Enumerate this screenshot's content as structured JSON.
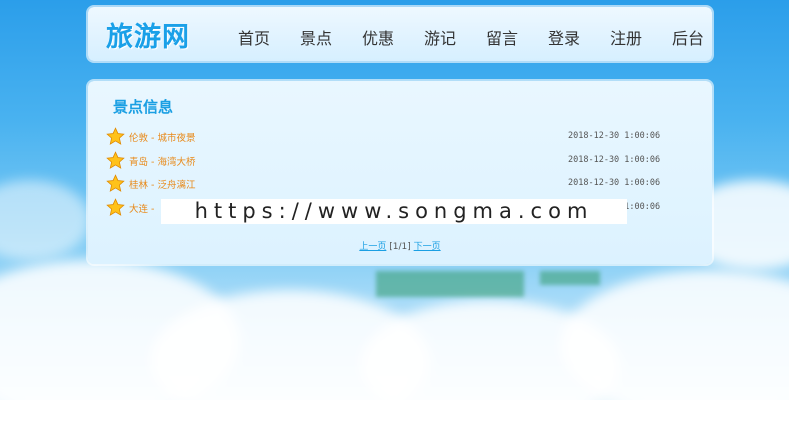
{
  "site": {
    "logo": "旅游网"
  },
  "nav": {
    "items": [
      "首页",
      "景点",
      "优惠",
      "游记",
      "留言",
      "登录",
      "注册",
      "后台"
    ]
  },
  "panel": {
    "title": "景点信息",
    "items": [
      {
        "label": "伦敦 - 城市夜景",
        "time": "2018-12-30 1:00:06"
      },
      {
        "label": "青岛 - 海湾大桥",
        "time": "2018-12-30 1:00:06"
      },
      {
        "label": "桂林 - 泛舟漓江",
        "time": "2018-12-30 1:00:06"
      },
      {
        "label": "大连 - ",
        "time": "2018-12-30 1:00:06"
      }
    ],
    "pager": {
      "prev": "上一页",
      "page": "[1/1]",
      "next": "下一页"
    }
  },
  "watermark": {
    "text": "https://www.songma.com"
  },
  "colors": {
    "accent": "#1aa0e8",
    "link_orange": "#e88a1a"
  },
  "icons": {
    "list_marker": "star-icon"
  }
}
